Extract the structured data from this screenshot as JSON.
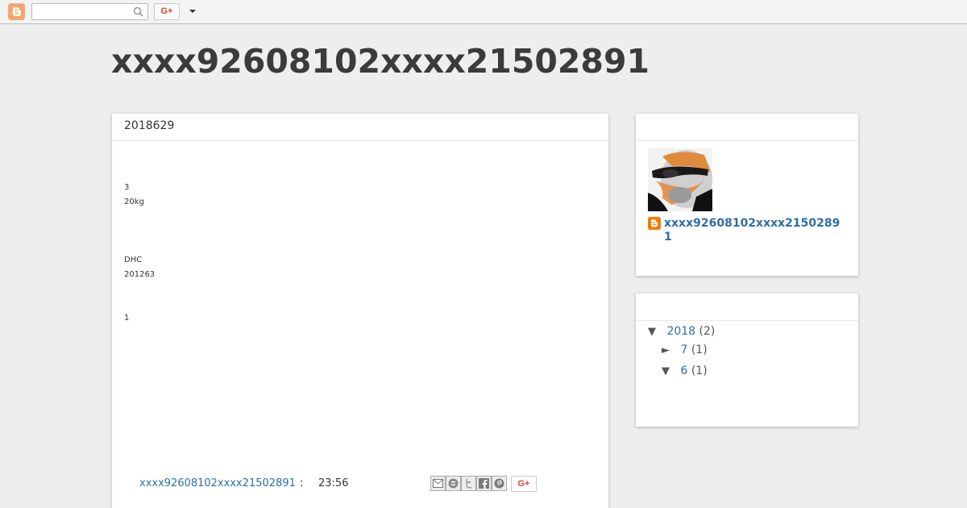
{
  "navbar": {
    "search_placeholder": "",
    "gplus_label": "G+",
    "icons": [
      "blogger-icon",
      "search-icon",
      "chevron-down-icon"
    ]
  },
  "blog": {
    "title": "xxxx92608102xxxx21502891"
  },
  "post": {
    "date_header": "2018629",
    "lines": [
      "3",
      "20kg",
      "DHC",
      "201263",
      "1"
    ],
    "author": "xxxx92608102xxxx21502891",
    "colon": ":",
    "time": "23:56",
    "share_gplus_label": "G+",
    "share_icons": [
      "email-icon",
      "blogthis-icon",
      "twitter-icon",
      "facebook-icon",
      "pinterest-icon"
    ]
  },
  "profile": {
    "title": "",
    "name": "xxxx92608102xxxx21502891"
  },
  "archive": {
    "title": "",
    "items": [
      {
        "toggle": "▼",
        "label": "2018",
        "count": "(2)"
      },
      {
        "toggle": "►",
        "label": "7",
        "count": "(1)"
      },
      {
        "toggle": "▼",
        "label": "6",
        "count": "(1)"
      }
    ]
  },
  "colors": {
    "link": "#2e6ea8",
    "background": "#eeeeee",
    "title": "#3b3b3b",
    "gplus": "#d14836",
    "blogger_orange": "#f57d00"
  }
}
